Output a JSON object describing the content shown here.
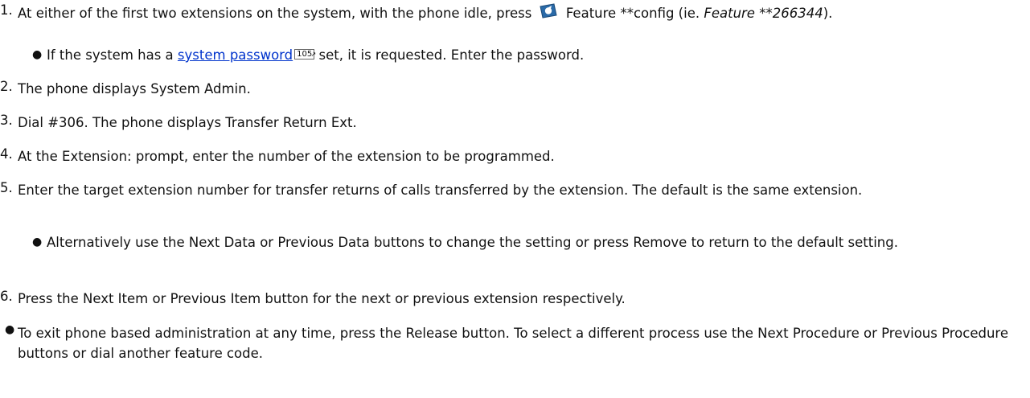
{
  "steps": [
    {
      "num": "1.",
      "pre": "At either of the first two extensions on the system, with the phone idle, press",
      "icon": "feature-key-icon",
      "post": "Feature **config (ie.",
      "italic": "Feature **266344",
      "end": ").",
      "sub": {
        "pre": "If the system has a",
        "link": "system password",
        "ref": "105",
        "post": "set, it is requested. Enter the password."
      }
    },
    {
      "num": "2.",
      "text": "The phone displays System Admin."
    },
    {
      "num": "3.",
      "text": "Dial #306. The phone displays Transfer Return Ext."
    },
    {
      "num": "4.",
      "text": "At the Extension: prompt, enter the number of the extension to be programmed."
    },
    {
      "num": "5.",
      "text": "Enter the target extension number for transfer returns of calls transferred by the extension. The default is the same extension.",
      "sub": {
        "text": "Alternatively use the Next Data or Previous Data buttons to change the setting or press Remove to return to the default setting."
      }
    },
    {
      "num": "6.",
      "text": "Press the Next Item or Previous Item button for the next or previous extension respectively."
    }
  ],
  "footer_bullet": "To exit phone based administration at any time, press the Release button. To select a different process use the Next Procedure or Previous Procedure buttons or dial another feature code.",
  "colors": {
    "link": "#0033cc",
    "icon": "#2a6aa8"
  }
}
